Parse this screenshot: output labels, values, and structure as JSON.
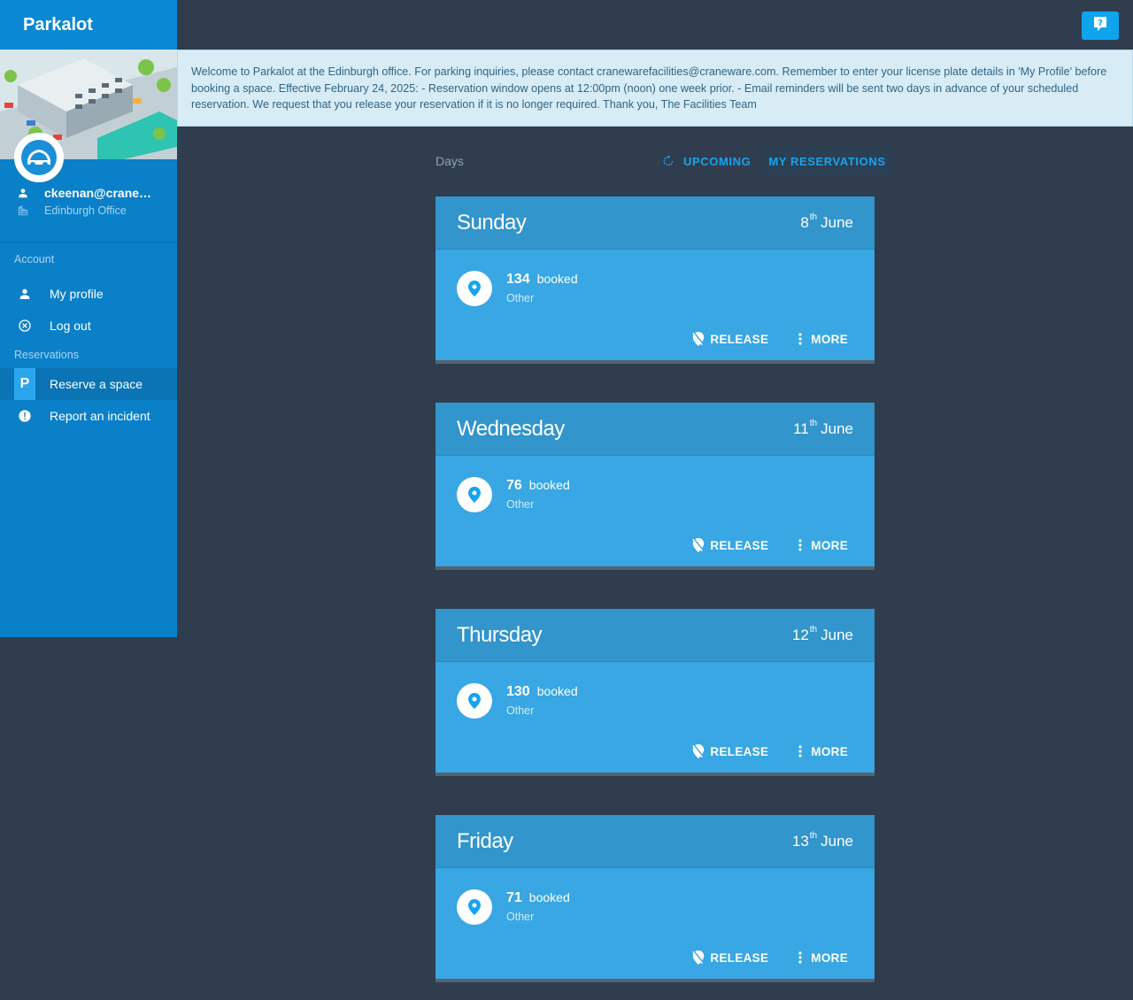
{
  "app": {
    "title": "Parkalot"
  },
  "user": {
    "email": "ckeenan@craneware.com",
    "office": "Edinburgh Office"
  },
  "sidebar": {
    "account_label": "Account",
    "reservations_label": "Reservations",
    "items": [
      {
        "label": "My profile",
        "icon": "person-icon"
      },
      {
        "label": "Log out",
        "icon": "cancel-circle-icon"
      },
      {
        "label": "Reserve a space",
        "icon": "p-badge",
        "badge": "P",
        "active": true
      },
      {
        "label": "Report an incident",
        "icon": "alert-circle-icon"
      }
    ]
  },
  "banner": {
    "text": "Welcome to Parkalot at the Edinburgh office. For parking inquiries, please contact cranewarefacilities@craneware.com. Remember to enter your license plate details in 'My Profile' before booking a space. Effective February 24, 2025: - Reservation window opens at 12:00pm (noon) one week prior. - Email reminders will be sent two days in advance of your scheduled reservation. We request that you release your reservation if it is no longer required. Thank you, The Facilities Team"
  },
  "header": {
    "days_label": "Days",
    "tab_upcoming": "UPCOMING",
    "tab_my_reservations": "MY RESERVATIONS"
  },
  "cards": [
    {
      "day": "Sunday",
      "date_num": "8",
      "date_suffix": "th",
      "month": "June",
      "spot": "134",
      "status": "booked",
      "type": "Other",
      "release": "RELEASE",
      "more": "MORE"
    },
    {
      "day": "Wednesday",
      "date_num": "11",
      "date_suffix": "th",
      "month": "June",
      "spot": "76",
      "status": "booked",
      "type": "Other",
      "release": "RELEASE",
      "more": "MORE"
    },
    {
      "day": "Thursday",
      "date_num": "12",
      "date_suffix": "th",
      "month": "June",
      "spot": "130",
      "status": "booked",
      "type": "Other",
      "release": "RELEASE",
      "more": "MORE"
    },
    {
      "day": "Friday",
      "date_num": "13",
      "date_suffix": "th",
      "month": "June",
      "spot": "71",
      "status": "booked",
      "type": "Other",
      "release": "RELEASE",
      "more": "MORE"
    }
  ],
  "colors": {
    "accent": "#0ea5ee",
    "sidebar": "#0a80c8",
    "card": "#38a7e3",
    "background": "#2f3d4f"
  }
}
